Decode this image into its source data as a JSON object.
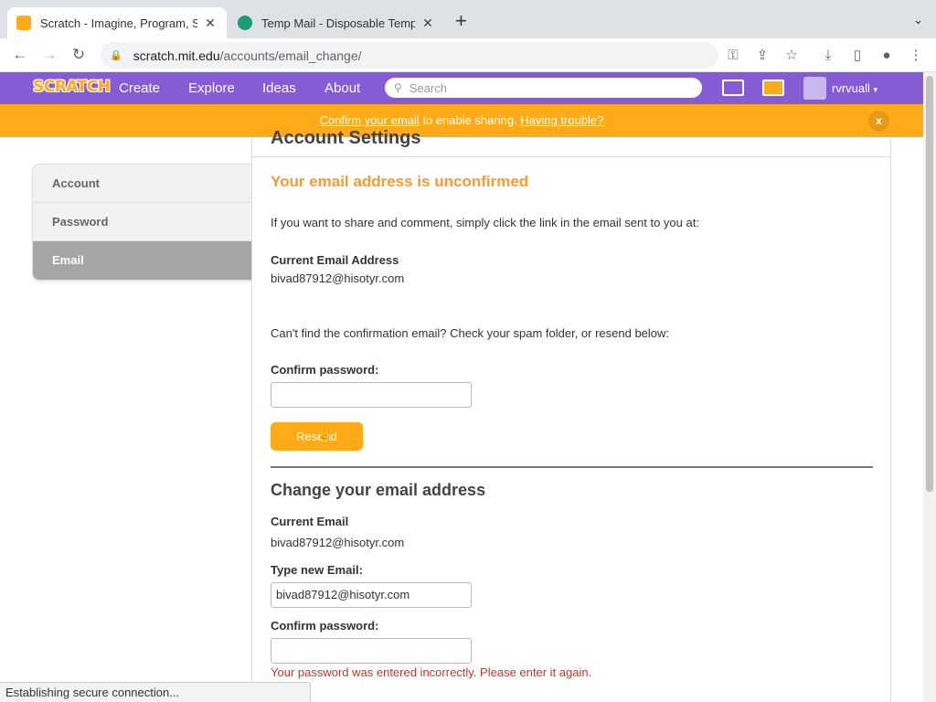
{
  "browser": {
    "tabs": [
      {
        "title": "Scratch - Imagine, Program, Sh",
        "favicon": "scratch-icon",
        "active": true
      },
      {
        "title": "Temp Mail - Disposable Tempo",
        "favicon": "tempmail-icon",
        "active": false
      }
    ],
    "url_host": "scratch.mit.edu",
    "url_path": "/accounts/email_change/",
    "status_text": "Establishing secure connection..."
  },
  "nav": {
    "logo": "SCRATCH",
    "links": [
      "Create",
      "Explore",
      "Ideas",
      "About"
    ],
    "search_placeholder": "Search",
    "username": "rvrvuall"
  },
  "banner": {
    "link1": "Confirm your email",
    "middle": " to enable sharing. ",
    "link2": "Having trouble?",
    "close": "x"
  },
  "sidebar": {
    "items": [
      {
        "label": "Account"
      },
      {
        "label": "Password"
      },
      {
        "label": "Email"
      }
    ]
  },
  "page": {
    "title": "Account Settings",
    "unconfirmed_heading": "Your email address is unconfirmed",
    "share_instructions": "If you want to share and comment, simply click the link in the email sent to you at:",
    "current_email_label": "Current Email Address",
    "current_email": "bivad87912@hisotyr.com",
    "resend_instructions": "Can't find the confirmation email? Check your spam folder, or resend below:",
    "confirm_password_label": "Confirm password:",
    "resend_button": "Resend",
    "change_heading": "Change your email address",
    "current_email_label2": "Current Email",
    "current_email2": "bivad87912@hisotyr.com",
    "new_email_label": "Type new Email:",
    "new_email_value": "bivad87912@hisotyr.com",
    "confirm_password_label2": "Confirm password:",
    "password_error": "Your password was entered incorrectly. Please enter it again."
  }
}
